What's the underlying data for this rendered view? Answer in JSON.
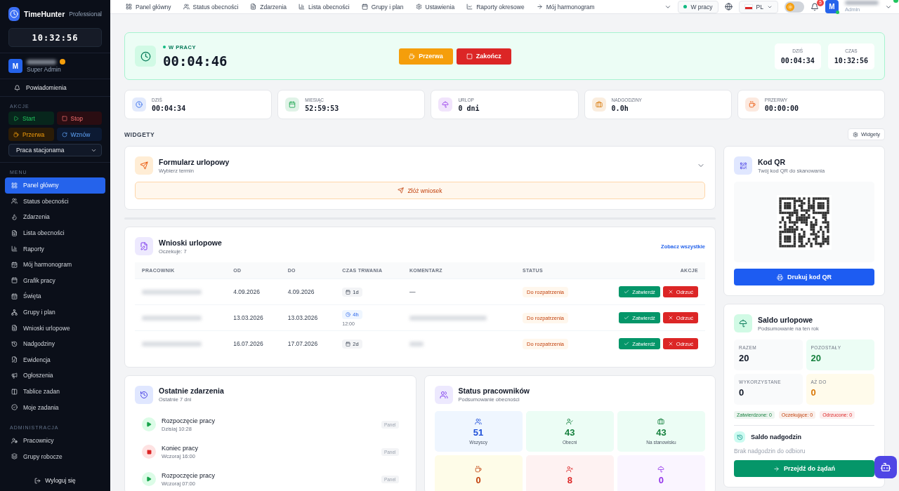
{
  "sidebar": {
    "brand": "TimeHunter",
    "plan": "Professional",
    "clock": "10:32:56",
    "user": {
      "initial": "M",
      "role": "Super Admin"
    },
    "notifications": "Powiadomienia",
    "actions_label": "AKCJE",
    "actions": [
      {
        "label": "Start",
        "kind": "start"
      },
      {
        "label": "Stop",
        "kind": "stop"
      },
      {
        "label": "Przerwa",
        "kind": "break"
      },
      {
        "label": "Wznów",
        "kind": "resume"
      }
    ],
    "mode": "Praca stacjonarna",
    "menu_label": "MENU",
    "menu": [
      {
        "label": "Panel główny",
        "selected": true
      },
      {
        "label": "Status obecności",
        "selected": false
      },
      {
        "label": "Zdarzenia",
        "selected": false
      },
      {
        "label": "Lista obecności",
        "selected": false
      },
      {
        "label": "Raporty",
        "selected": false
      },
      {
        "label": "Mój harmonogram",
        "selected": false
      },
      {
        "label": "Grafik pracy",
        "selected": false
      },
      {
        "label": "Święta",
        "selected": false
      },
      {
        "label": "Grupy i plan",
        "selected": false
      },
      {
        "label": "Wnioski urlopowe",
        "selected": false
      },
      {
        "label": "Nadgodziny",
        "selected": false
      },
      {
        "label": "Ewidencja",
        "selected": false
      },
      {
        "label": "Ogłoszenia",
        "selected": false
      },
      {
        "label": "Tablice zadan",
        "selected": false
      },
      {
        "label": "Moje zadania",
        "selected": false
      }
    ],
    "admin_label": "ADMINISTRACJA",
    "admin": [
      {
        "label": "Pracownicy",
        "selected": false
      },
      {
        "label": "Grupy robocze",
        "selected": false
      }
    ],
    "logout": "Wyloguj się"
  },
  "topnav": {
    "items": [
      "Panel główny",
      "Status obecności",
      "Zdarzenia",
      "Lista obecności",
      "Grupy i plan",
      "Ustawienia",
      "Raporty okresowe",
      "Mój harmonogram"
    ],
    "status": "W pracy",
    "language": "PL",
    "dark_mode": false,
    "notifications": "5",
    "user": {
      "initial": "M",
      "role": "Admin"
    }
  },
  "work": {
    "status": "W PRACY",
    "timer": "00:04:46",
    "buttons": [
      {
        "label": "Przerwa",
        "kind": "break"
      },
      {
        "label": "Zakończ",
        "kind": "stop"
      }
    ],
    "stats": [
      {
        "label": "DZIŚ",
        "value": "00:04:34"
      },
      {
        "label": "CZAS",
        "value": "10:32:56"
      }
    ]
  },
  "summary": [
    {
      "label": "DZIŚ",
      "value": "00:04:34",
      "kind": "clock"
    },
    {
      "label": "MIESIĄC",
      "value": "52:59:53",
      "kind": "calendar"
    },
    {
      "label": "URLOP",
      "value": "0 dni",
      "kind": "vacation"
    },
    {
      "label": "NADGODZINY",
      "value": "0.0h",
      "kind": "overtime"
    },
    {
      "label": "PRZERWY",
      "value": "00:00:00",
      "kind": "break"
    }
  ],
  "widgets": {
    "label": "WIDGETY",
    "button": "Widgety"
  },
  "leave_form": {
    "title": "Formularz urlopowy",
    "subtitle": "Wybierz termin",
    "submit": "Złóż wniosek"
  },
  "requests": {
    "title": "Wnioski urlopowe",
    "subtitle": "Oczekuje: 7",
    "link": "Zobacz wszystkie",
    "columns": [
      "PRACOWNIK",
      "OD",
      "DO",
      "CZAS TRWANIA",
      "KOMENTARZ",
      "STATUS",
      "AKCJE"
    ],
    "rows": [
      {
        "from": "4.09.2026",
        "to": "4.09.2026",
        "duration": "1d",
        "kind": "days",
        "comment": "—",
        "status": "Do rozpatrzenia",
        "approve": "Zatwierdź",
        "reject": "Odrzuć"
      },
      {
        "from": "13.03.2026",
        "to": "13.03.2026",
        "duration": "4h",
        "duration_note": "12:00",
        "kind": "hours",
        "status": "Do rozpatrzenia",
        "approve": "Zatwierdź",
        "reject": "Odrzuć"
      },
      {
        "from": "16.07.2026",
        "to": "17.07.2026",
        "duration": "2d",
        "kind": "days",
        "status": "Do rozpatrzenia",
        "approve": "Zatwierdź",
        "reject": "Odrzuć"
      }
    ]
  },
  "events": {
    "title": "Ostatnie zdarzenia",
    "subtitle": "Ostatnie 7 dni",
    "items": [
      {
        "title": "Rozpoczęcie pracy",
        "time": "Dzisiaj 10:28",
        "source": "Panel",
        "kind": "start"
      },
      {
        "title": "Koniec pracy",
        "time": "Wczoraj 16:00",
        "source": "Panel",
        "kind": "stop"
      },
      {
        "title": "Rozpoczęcie pracy",
        "time": "Wczoraj 07:00",
        "source": "Panel",
        "kind": "start"
      }
    ]
  },
  "staff": {
    "title": "Status pracowników",
    "subtitle": "Podsumowanie obecności",
    "tiles": [
      {
        "value": "51",
        "label": "Wszyscy",
        "kind": "all",
        "color": "#1d4ed8"
      },
      {
        "value": "43",
        "label": "Obecni",
        "kind": "present",
        "color": "#15803d"
      },
      {
        "value": "43",
        "label": "Na stanowisku",
        "kind": "desk",
        "color": "#15803d"
      },
      {
        "value": "0",
        "kind": "break",
        "color": "#c2410c"
      },
      {
        "value": "8",
        "kind": "absent",
        "color": "#dc2626"
      },
      {
        "value": "0",
        "kind": "vacation",
        "color": "#9333ea"
      }
    ]
  },
  "qr": {
    "title": "Kod QR",
    "subtitle": "Twój kod QR do skanowania",
    "button": "Drukuj kod QR"
  },
  "balance": {
    "title": "Saldo urlopowe",
    "subtitle": "Podsumowanie na ten rok",
    "stats": [
      {
        "label": "RAZEM",
        "value": "20",
        "color": "#111827"
      },
      {
        "label": "POZOSTAŁY",
        "value": "20",
        "color": "#15803d"
      },
      {
        "label": "WYKORZYSTANE",
        "value": "0",
        "color": "#111827"
      },
      {
        "label": "AŻ DO",
        "value": "0",
        "color": "#d97706"
      }
    ],
    "chips": [
      {
        "label": "Zatwierdzone: 0",
        "kind": "approved"
      },
      {
        "label": "Oczekujące: 0",
        "kind": "pending"
      },
      {
        "label": "Odrzucone: 0",
        "kind": "rejected"
      }
    ],
    "overtime_title": "Saldo nadgodzin",
    "overtime_empty": "Brak nadgodzin do odbioru",
    "button": "Przejdź do żądań"
  }
}
